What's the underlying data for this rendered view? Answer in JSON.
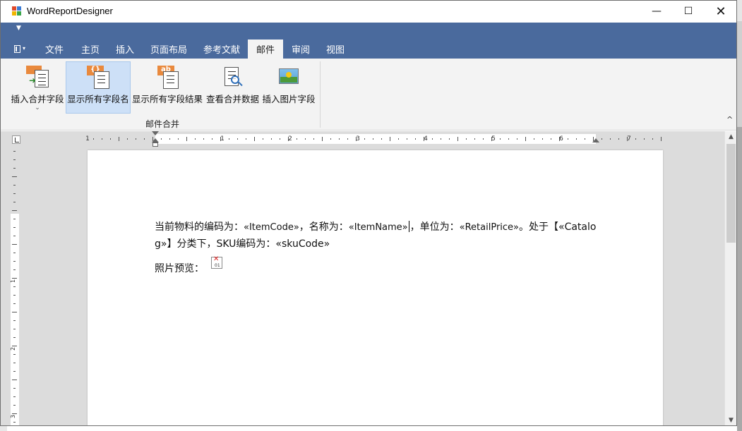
{
  "window": {
    "title": "WordReportDesigner",
    "controls": {
      "minimize": "—",
      "maximize": "☐",
      "close": "✕"
    }
  },
  "ribbon": {
    "tabs": [
      {
        "label": "文件"
      },
      {
        "label": "主页"
      },
      {
        "label": "插入"
      },
      {
        "label": "页面布局"
      },
      {
        "label": "参考文献"
      },
      {
        "label": "邮件"
      },
      {
        "label": "审阅"
      },
      {
        "label": "视图"
      }
    ],
    "active_tab": "邮件",
    "buttons": {
      "insert_merge_field": "插入合并字段",
      "show_field_names": "显示所有字段名",
      "show_field_results": "显示所有字段结果",
      "view_merge_data": "查看合并数据",
      "insert_image_field": "插入图片字段"
    },
    "icon_text": {
      "field_braces": "{}",
      "ab": "ab"
    },
    "group_label": "邮件合并"
  },
  "ruler": {
    "numbers": [
      "1",
      "1",
      "2",
      "3",
      "4",
      "5",
      "6",
      "7"
    ]
  },
  "vruler": {
    "numbers": [
      "1",
      "2",
      "3"
    ]
  },
  "document": {
    "line1_parts": [
      "当前物料的编码为：",
      "«ItemCode»",
      "，名称为：",
      "«ItemName»",
      "，单位为：",
      "«RetailPrice»",
      "。处于【",
      "«Catalo"
    ],
    "line2_parts": [
      "g»",
      "】分类下，SKU编码为：",
      "«skuCode»"
    ],
    "line3_label": "照片预览：",
    "image_placeholder": "01"
  },
  "colors": {
    "ribbon_blue": "#4a6a9d",
    "ribbon_body": "#f3f3f3",
    "selected_button": "#cde0f7",
    "icon_orange": "#e9893d"
  }
}
